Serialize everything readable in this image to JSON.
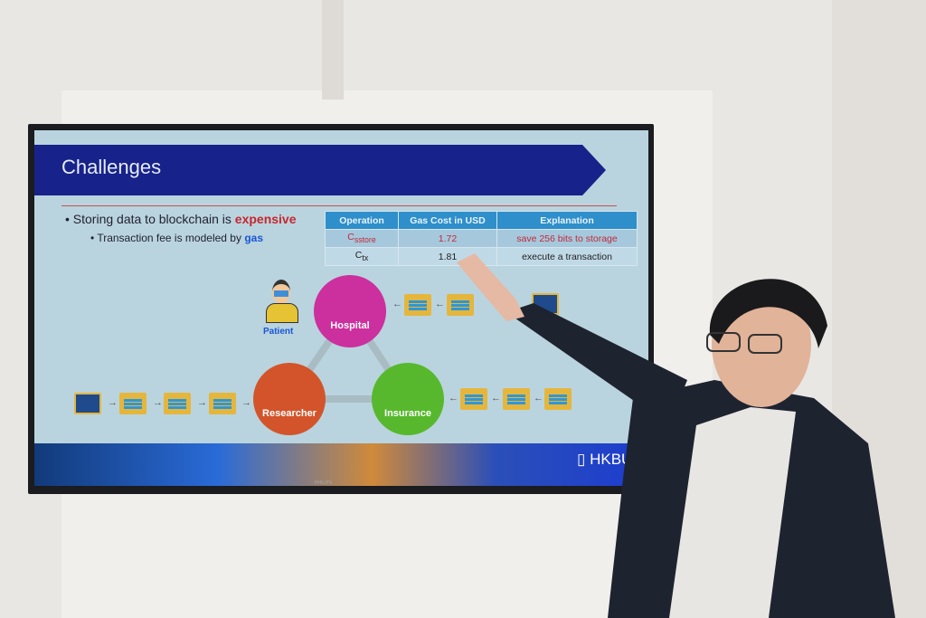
{
  "slide": {
    "title": "Challenges",
    "bullet1_text": "Storing data to blockchain is ",
    "bullet1_emph": "expensive",
    "bullet2_text": "Transaction fee is modeled by ",
    "bullet2_emph": "gas",
    "table": {
      "headers": [
        "Operation",
        "Gas Cost in USD",
        "Explanation"
      ],
      "rows": [
        {
          "op": "C",
          "op_sub": "sstore",
          "cost": "1.72",
          "explanation": "save 256 bits to storage"
        },
        {
          "op": "C",
          "op_sub": "tx",
          "cost": "1.81",
          "explanation": "execute a transaction"
        }
      ]
    },
    "diagram": {
      "patient": "Patient",
      "hospital": "Hospital",
      "researcher": "Researcher",
      "insurance": "Insurance"
    },
    "logo": "HKBU",
    "colors": {
      "banner": "#17228a",
      "hospital": "#cc2f9e",
      "researcher": "#d3542a",
      "insurance": "#57b82d",
      "accent_red": "#c8262e",
      "gas_blue": "#1a55d6"
    }
  },
  "monitor_brand": "PHILIPS"
}
